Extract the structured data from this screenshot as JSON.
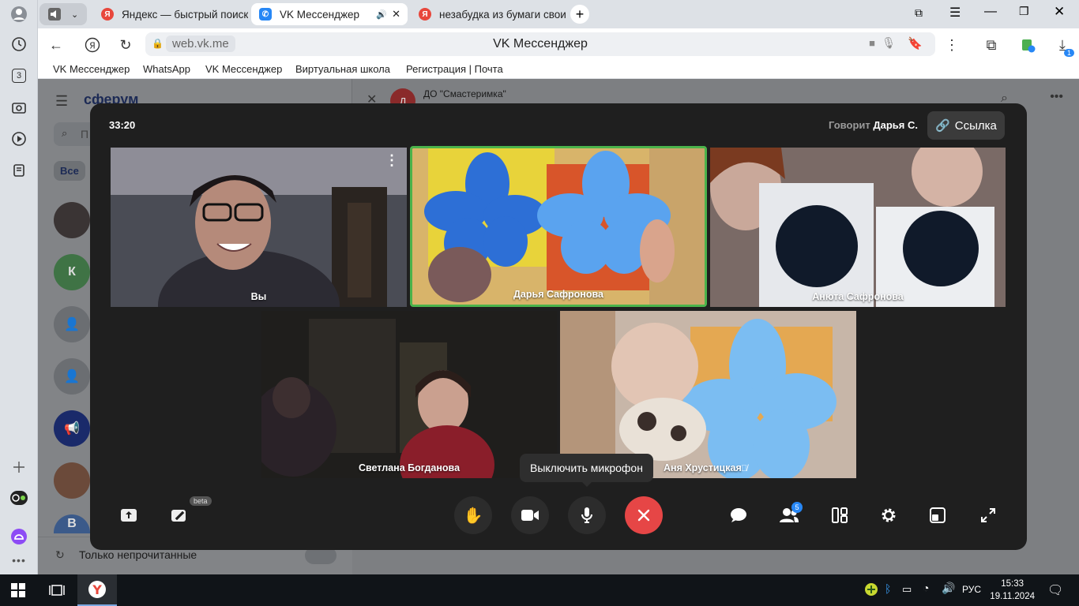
{
  "browser": {
    "tabs": [
      {
        "label": "Яндекс — быстрый поиск",
        "favicon": "yandex-icon"
      },
      {
        "label": "VK Мессенджер",
        "favicon": "vk-messenger-icon",
        "active": true
      },
      {
        "label": "незабудка из бумаги свои",
        "favicon": "yandex-icon"
      }
    ],
    "address": {
      "url": "web.vk.me",
      "title": "VK Мессенджер"
    },
    "bookmarks": [
      "VK Мессенджер",
      "WhatsApp",
      "VK Мессенджер",
      "Виртуальная школа",
      "Регистрация | Почта"
    ],
    "rail_counter": "3",
    "download_badge": "1"
  },
  "background_app": {
    "logo": "сферум",
    "search_placeholder": "П",
    "filter_all": "Все",
    "contact_initial": "К",
    "contact_initial_2": "В",
    "chat_title": "ДО \"Смастеримка\"",
    "chat_avatar": "Д",
    "unread_only_label": "Только непрочитанные"
  },
  "call": {
    "timer": "33:20",
    "speaking_prefix": "Говорит",
    "speaking_name": "Дарья С.",
    "link_label": "Ссылка",
    "participants": [
      {
        "name": "Вы"
      },
      {
        "name": "Дарья Сафронова"
      },
      {
        "name": "Анюта Сафронова"
      },
      {
        "name": "Светлана Богданова"
      },
      {
        "name": "Аня Хрустицкая"
      }
    ],
    "beta_label": "beta",
    "participants_count": "5",
    "tooltip": "Выключить микрофон",
    "colors": {
      "end_call": "#e64646",
      "speaker_border": "#4bb34b",
      "badge": "#2787f5"
    }
  },
  "taskbar": {
    "lang": "РУС",
    "time": "15:33",
    "date": "19.11.2024"
  }
}
